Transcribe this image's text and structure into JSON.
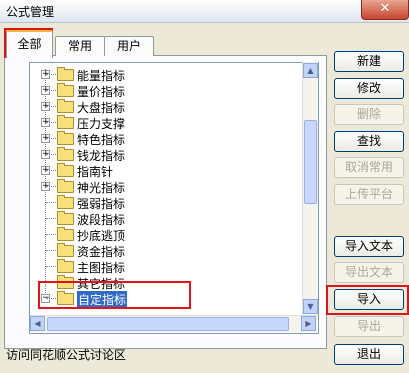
{
  "window": {
    "title": "公式管理",
    "close_label": "✕"
  },
  "tabs": [
    {
      "label": "全部",
      "active": true
    },
    {
      "label": "常用",
      "active": false
    },
    {
      "label": "用户",
      "active": false
    }
  ],
  "tree": {
    "items": [
      {
        "label": "能量指标",
        "expandable": true,
        "expander": "+"
      },
      {
        "label": "量价指标",
        "expandable": true,
        "expander": "+"
      },
      {
        "label": "大盘指标",
        "expandable": true,
        "expander": "+"
      },
      {
        "label": "压力支撑",
        "expandable": true,
        "expander": "+"
      },
      {
        "label": "特色指标",
        "expandable": true,
        "expander": "+"
      },
      {
        "label": "钱龙指标",
        "expandable": true,
        "expander": "+"
      },
      {
        "label": "指南针",
        "expandable": true,
        "expander": "+"
      },
      {
        "label": "神光指标",
        "expandable": true,
        "expander": "+"
      },
      {
        "label": "强弱指标",
        "expandable": false
      },
      {
        "label": "波段指标",
        "expandable": false
      },
      {
        "label": "抄底逃顶",
        "expandable": false
      },
      {
        "label": "资金指标",
        "expandable": false
      },
      {
        "label": "主图指标",
        "expandable": false
      },
      {
        "label": "其它指标",
        "expandable": false
      },
      {
        "label": "自定指标",
        "expandable": true,
        "expander": "−",
        "selected": true
      }
    ]
  },
  "buttons": [
    {
      "label": "新建",
      "enabled": true
    },
    {
      "label": "修改",
      "enabled": true
    },
    {
      "label": "删除",
      "enabled": false
    },
    {
      "label": "查找",
      "enabled": true
    },
    {
      "label": "取消常用",
      "enabled": false
    },
    {
      "label": "上传平台",
      "enabled": false
    },
    {
      "label": "导入文本",
      "enabled": true
    },
    {
      "label": "导出文本",
      "enabled": false
    },
    {
      "label": "导入",
      "enabled": true
    },
    {
      "label": "导出",
      "enabled": false
    },
    {
      "label": "退出",
      "enabled": true
    }
  ],
  "footer": {
    "link_text": "访问同花顺公式讨论区"
  },
  "scroll_icons": {
    "up": "▲",
    "down": "▼",
    "left": "◀",
    "right": "▶"
  },
  "colors": {
    "highlight_box": "#e0121b",
    "selection": "#316ac5"
  }
}
